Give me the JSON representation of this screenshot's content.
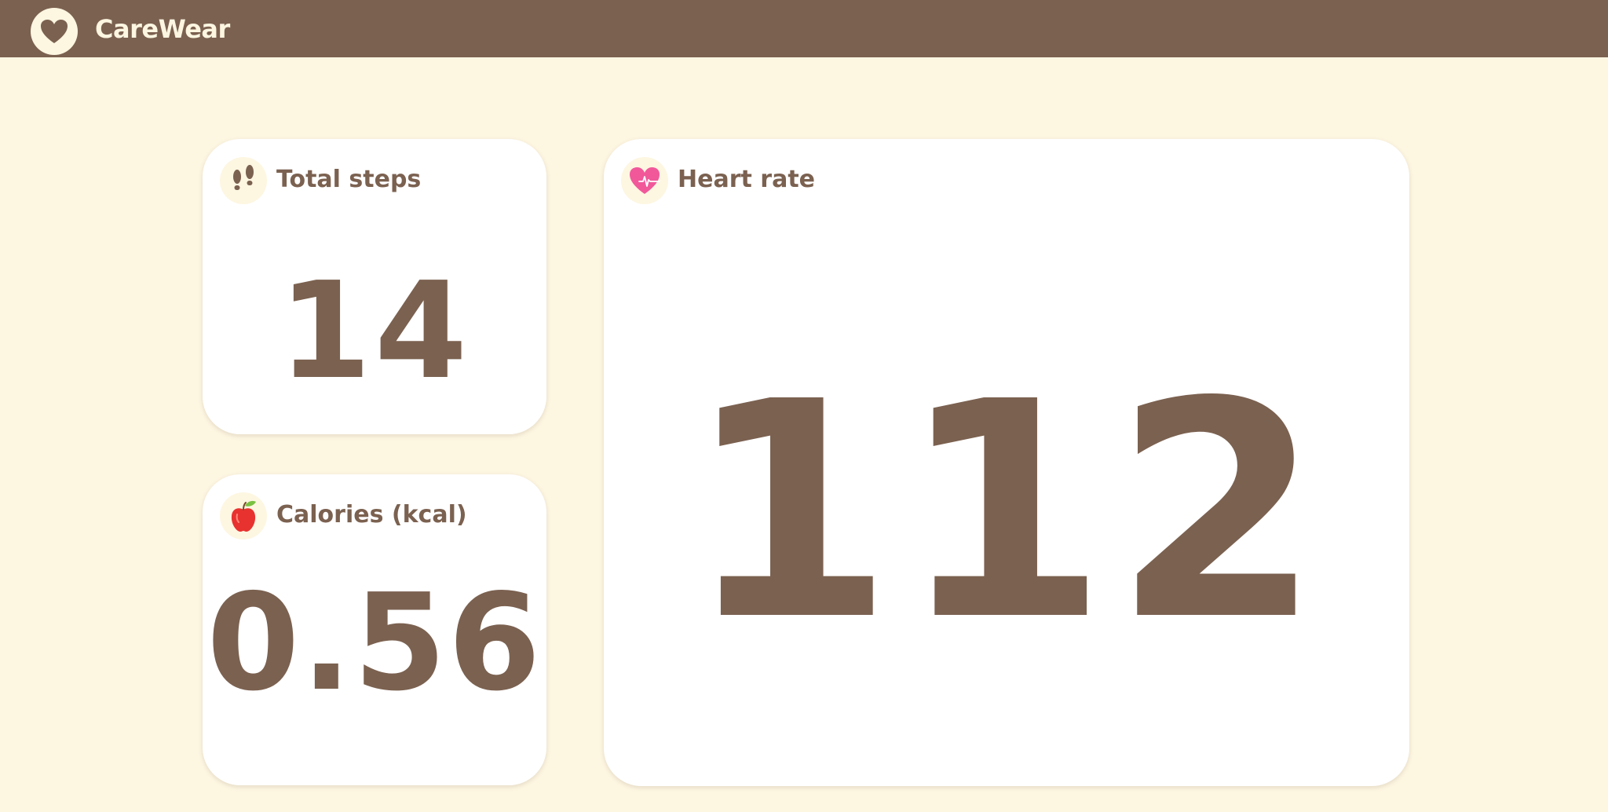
{
  "header": {
    "brand_name": "CareWear",
    "logo_icon": "heart-icon"
  },
  "colors": {
    "brand": "#7b6150",
    "background": "#fdf6e1",
    "card": "#ffffff",
    "heart_pink": "#f1589a",
    "apple_red": "#e8322f"
  },
  "cards": {
    "steps": {
      "icon": "footsteps-icon",
      "title": "Total steps",
      "value": "14"
    },
    "calories": {
      "icon": "apple-icon",
      "title": "Calories (kcal)",
      "value": "0.56"
    },
    "heart_rate": {
      "icon": "heart-pulse-icon",
      "title": "Heart rate",
      "value": "112"
    }
  }
}
